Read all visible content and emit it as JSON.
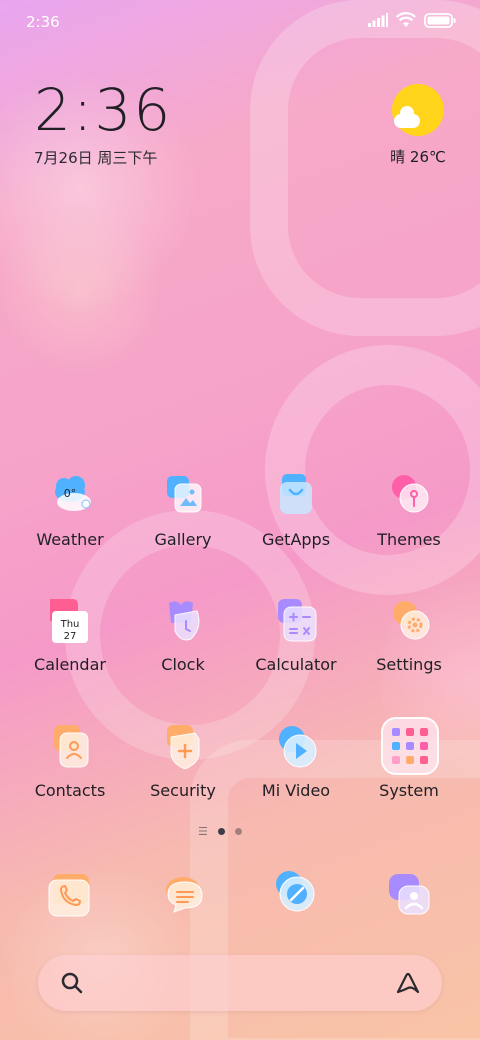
{
  "status_bar": {
    "time": "2:36",
    "icons": [
      "signal-icon",
      "wifi-icon",
      "battery-icon"
    ]
  },
  "clock_widget": {
    "time": "2:36",
    "date": "7月26日 周三下午"
  },
  "weather_widget": {
    "condition": "晴 26℃",
    "icon": "sun-cloud-icon"
  },
  "apps": [
    {
      "label": "Weather",
      "icon": "weather-icon",
      "badge": "0°"
    },
    {
      "label": "Gallery",
      "icon": "gallery-icon"
    },
    {
      "label": "GetApps",
      "icon": "getapps-icon"
    },
    {
      "label": "Themes",
      "icon": "themes-icon"
    },
    {
      "label": "Calendar",
      "icon": "calendar-icon",
      "day_name": "Thu",
      "day_number": "27"
    },
    {
      "label": "Clock",
      "icon": "clock-icon"
    },
    {
      "label": "Calculator",
      "icon": "calculator-icon"
    },
    {
      "label": "Settings",
      "icon": "settings-icon"
    },
    {
      "label": "Contacts",
      "icon": "contacts-icon"
    },
    {
      "label": "Security",
      "icon": "security-icon"
    },
    {
      "label": "Mi Video",
      "icon": "mi-video-icon"
    },
    {
      "label": "System",
      "icon": "system-folder-icon"
    }
  ],
  "page_indicator": {
    "pages": 2,
    "current": 1
  },
  "dock": [
    {
      "icon": "phone-icon"
    },
    {
      "icon": "messages-icon"
    },
    {
      "icon": "browser-icon"
    },
    {
      "icon": "chat-icon"
    }
  ],
  "search_bar": {
    "left_icon": "search-icon",
    "right_icon": "assistant-icon"
  },
  "colors": {
    "accent_orange": "#ffab6a",
    "accent_blue": "#4fb1ff",
    "accent_pink": "#ff5ea8",
    "accent_purple": "#a88cff",
    "sun_yellow": "#ffd41a"
  }
}
